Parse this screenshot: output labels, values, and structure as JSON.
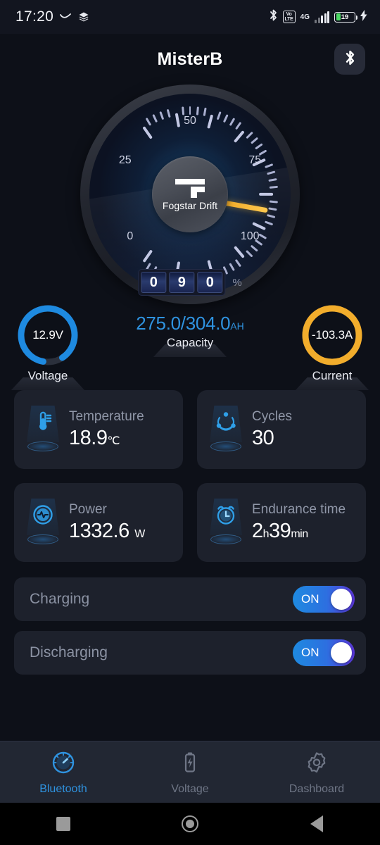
{
  "status_bar": {
    "time": "17:20",
    "icons_left": [
      "curve-icon",
      "layers-icon"
    ],
    "icons_right": [
      "bluetooth-icon",
      "volte-icon",
      "4g-icon",
      "signal-icon",
      "battery-icon",
      "charging-bolt-icon"
    ],
    "volte_top": "Vo",
    "volte_bottom": "LTE",
    "network": "4G",
    "battery_percent": "19"
  },
  "app_bar": {
    "title": "MisterB",
    "bluetooth_button_icon": "bluetooth-icon"
  },
  "gauge": {
    "brand": "Fogstar Drift",
    "min": 0,
    "max": 100,
    "value": 90,
    "tick_labels": [
      "0",
      "25",
      "50",
      "75",
      "100"
    ],
    "digits": [
      "0",
      "9",
      "0"
    ],
    "unit": "%",
    "needle_color": "#f2ad2c"
  },
  "readouts": {
    "voltage": {
      "value": "12.9V",
      "label": "Voltage",
      "color": "#1e8ae0",
      "arc_percent": 88
    },
    "capacity": {
      "value": "275.0/304.0",
      "unit": "AH",
      "label": "Capacity",
      "color": "#2f93e0"
    },
    "current": {
      "value": "-103.3A",
      "label": "Current",
      "color": "#f2ad2c",
      "arc_percent": 100
    }
  },
  "cards": [
    {
      "icon": "thermometer-icon",
      "label": "Temperature",
      "value": "18.9",
      "unit": "℃"
    },
    {
      "icon": "cycles-icon",
      "label": "Cycles",
      "value": "30",
      "unit": ""
    },
    {
      "icon": "power-pulse-icon",
      "label": "Power",
      "value": "1332.6",
      "unit": "W"
    },
    {
      "icon": "alarm-clock-icon",
      "label": "Endurance time",
      "value": "2",
      "unit": "h",
      "value2": "39",
      "unit2": "min"
    }
  ],
  "switches": [
    {
      "label": "Charging",
      "state": "ON"
    },
    {
      "label": "Discharging",
      "state": "ON"
    }
  ],
  "bottom_nav": [
    {
      "icon": "gauge-icon",
      "label": "Bluetooth",
      "active": true
    },
    {
      "icon": "battery-icon",
      "label": "Voltage",
      "active": false
    },
    {
      "icon": "gear-icon",
      "label": "Dashboard",
      "active": false
    }
  ],
  "system_nav": [
    "recents-square-icon",
    "home-circle-icon",
    "back-triangle-icon"
  ]
}
